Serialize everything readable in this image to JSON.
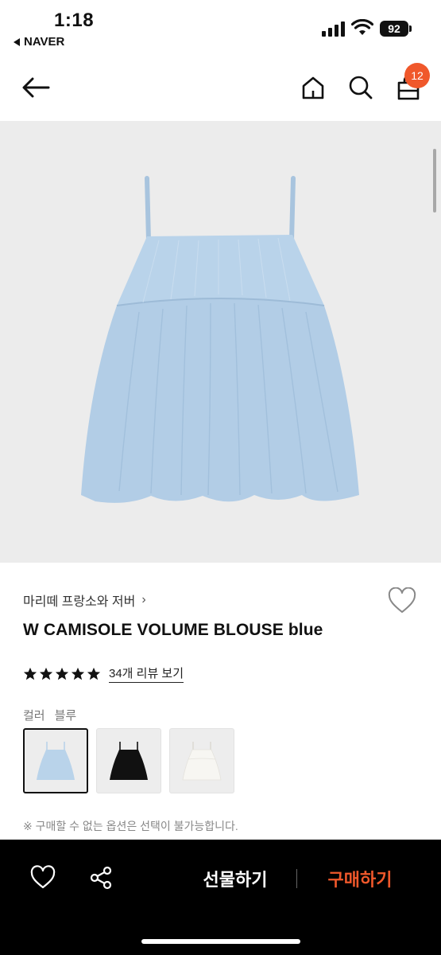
{
  "status_bar": {
    "time": "1:18",
    "back_app": "NAVER",
    "battery": "92"
  },
  "nav": {
    "cart_count": "12"
  },
  "product": {
    "brand": "마리떼 프랑소와 저버",
    "title": "W CAMISOLE VOLUME BLOUSE blue",
    "rating_stars": 5,
    "review_link": "34개 리뷰 보기",
    "option_label": "컬러",
    "option_value": "블루",
    "swatches": [
      {
        "color": "#b9d3ea",
        "selected": true
      },
      {
        "color": "#111111",
        "selected": false
      },
      {
        "color": "#f2f2ee",
        "selected": false
      }
    ],
    "notice": "※ 구매할 수 없는 옵션은 선택이 불가능합니다."
  },
  "bottom_bar": {
    "gift_label": "선물하기",
    "buy_label": "구매하기"
  },
  "colors": {
    "accent": "#f0582b",
    "garment": "#b9d3ea",
    "background_image": "#ececec"
  }
}
